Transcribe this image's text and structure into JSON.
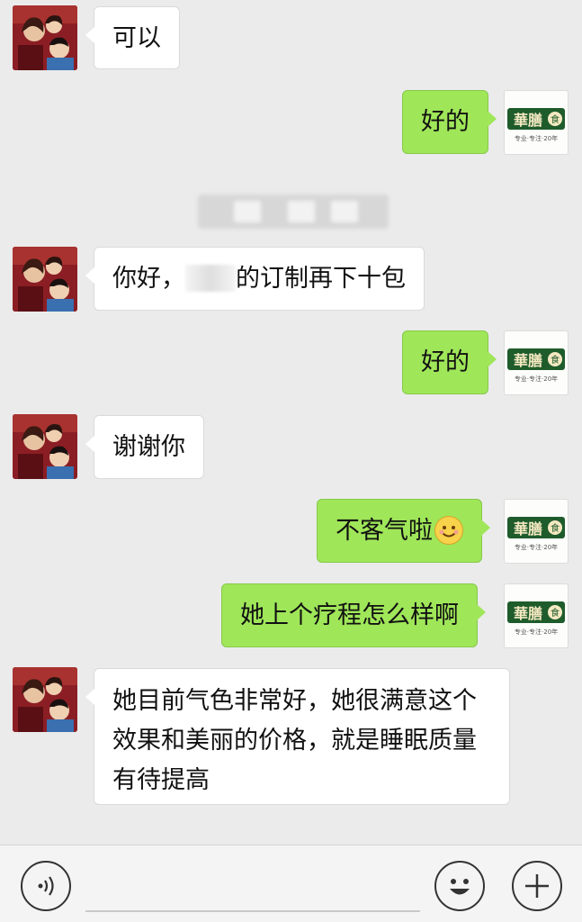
{
  "messages": [
    {
      "side": "in",
      "text": "可以"
    },
    {
      "side": "out",
      "text": "好的"
    },
    {
      "side": "in",
      "text_before": "你好，",
      "text_after": "的订制再下十包"
    },
    {
      "side": "out",
      "text": "好的"
    },
    {
      "side": "in",
      "text": "谢谢你"
    },
    {
      "side": "out",
      "text": "不客气啦",
      "icon": "smile-emoji-icon"
    },
    {
      "side": "out",
      "text": "她上个疗程怎么样啊"
    },
    {
      "side": "in",
      "text": "她目前气色非常好，她很满意这个效果和美丽的价格，就是睡眠质量有待提高"
    }
  ],
  "brand_avatar": {
    "logo_text": "華膳",
    "logo_badge": "食",
    "tagline": "专业·专注·20年"
  },
  "colors": {
    "outgoing_bubble": "#9fe659",
    "incoming_bubble": "#ffffff",
    "background": "#ebebeb"
  },
  "input_bar": {
    "voice_icon": "voice-icon",
    "emoji_icon": "emoji-icon",
    "more_icon": "plus-icon"
  }
}
